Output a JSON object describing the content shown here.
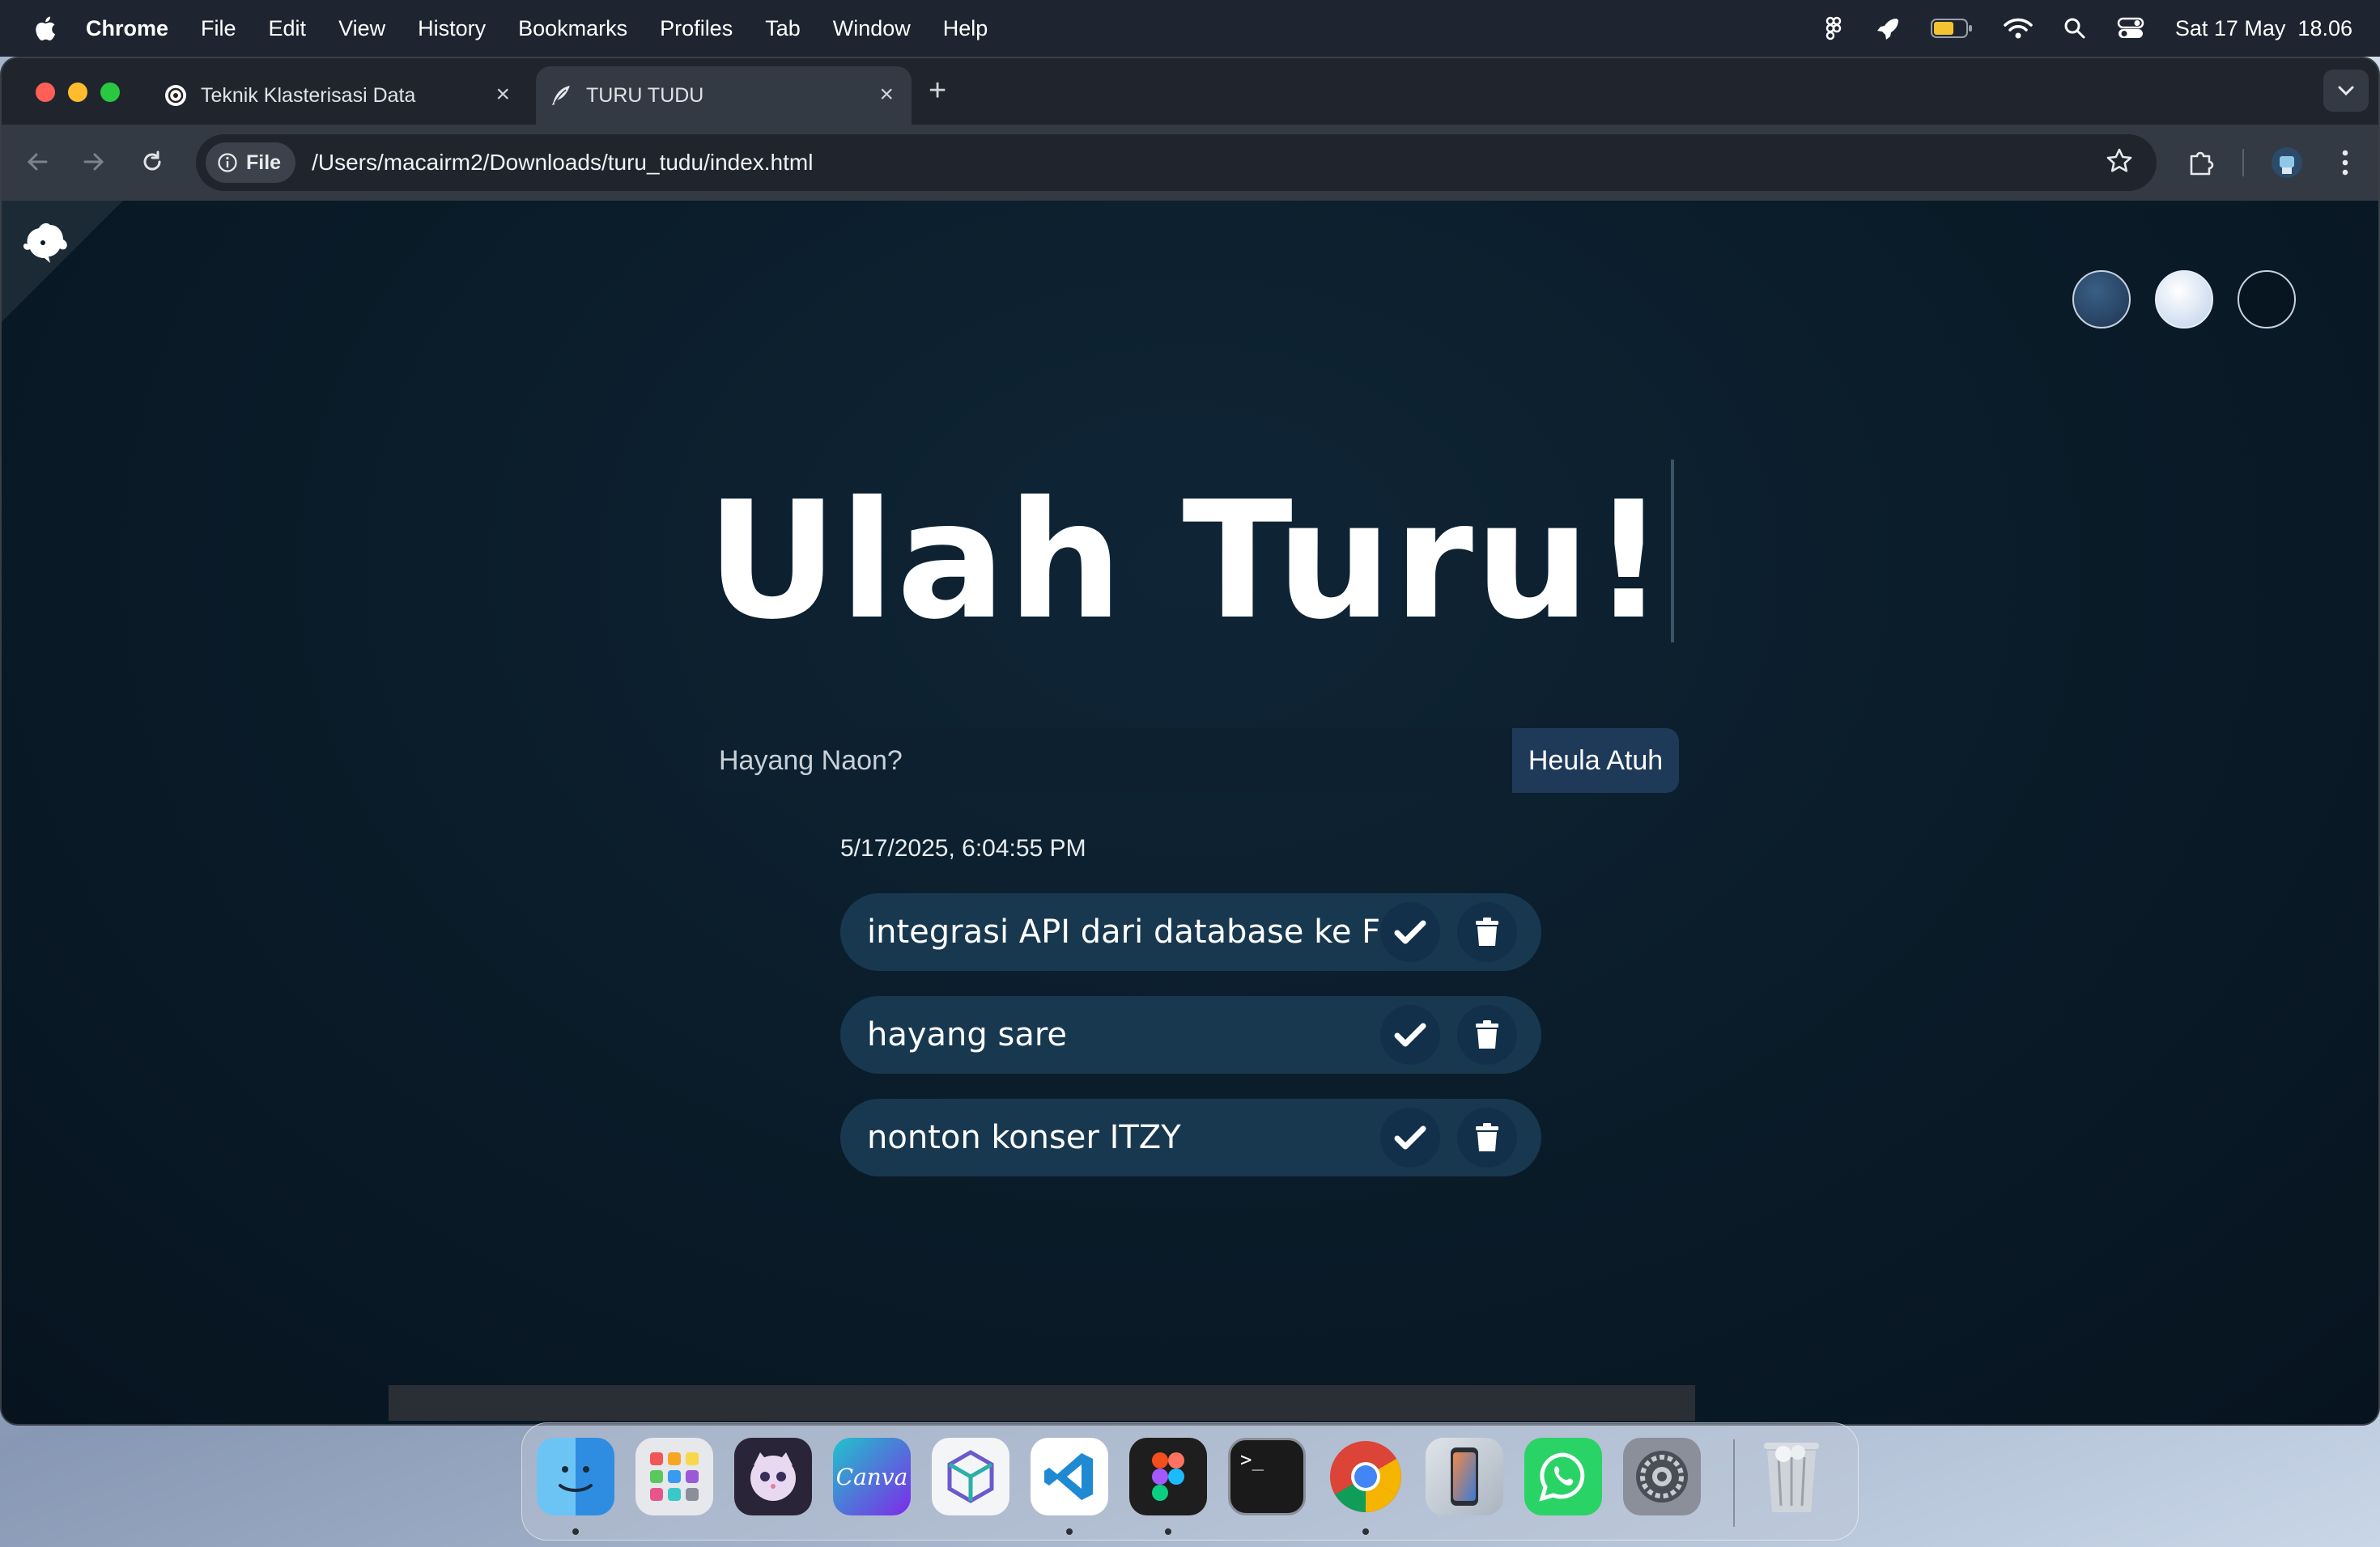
{
  "menubar": {
    "app_name": "Chrome",
    "items": [
      "File",
      "Edit",
      "View",
      "History",
      "Bookmarks",
      "Profiles",
      "Tab",
      "Window",
      "Help"
    ],
    "clock": "Sat 17 May  18.06",
    "status_icons": [
      "figma-icon",
      "rocket-icon",
      "battery-icon",
      "wifi-icon",
      "spotlight-search-icon",
      "control-center-icon"
    ]
  },
  "browser": {
    "tabs": [
      {
        "title": "Teknik Klasterisasi Data",
        "favicon": "openai-icon",
        "active": false
      },
      {
        "title": "TURU TUDU",
        "favicon": "quill-icon",
        "active": true
      }
    ],
    "omnibox": {
      "chip_label": "File",
      "url": "/Users/macairm2/Downloads/turu_tudu/index.html"
    }
  },
  "page": {
    "heading": "Ulah Turu!",
    "input_placeholder": "Hayang Naon?",
    "submit_label": "Heula Atuh",
    "datetime": "5/17/2025, 6:04:55 PM",
    "theme_options": [
      {
        "name": "standard",
        "color": "#2e4e70"
      },
      {
        "name": "light",
        "color": "#e8f0fa"
      },
      {
        "name": "darker",
        "color": "#071520"
      }
    ],
    "todos": [
      {
        "text": "integrasi API dari database ke FE"
      },
      {
        "text": "hayang sare"
      },
      {
        "text": "nonton konser ITZY"
      }
    ]
  },
  "dock": {
    "apps": [
      "finder-icon",
      "launchpad-icon",
      "cat-app-icon",
      "canva-icon",
      "app-3d-icon",
      "vscode-icon",
      "figma-app-icon",
      "terminal-icon",
      "chrome-icon",
      "iphone-mirroring-icon",
      "whatsapp-icon",
      "system-settings-icon",
      "trash-icon"
    ],
    "canva_label": "Canva",
    "terminal_prompt": ">_"
  },
  "colors": {
    "page_bg": "#0a1b28",
    "todo_bg": "#183850",
    "button_bg": "#1f3a58"
  }
}
